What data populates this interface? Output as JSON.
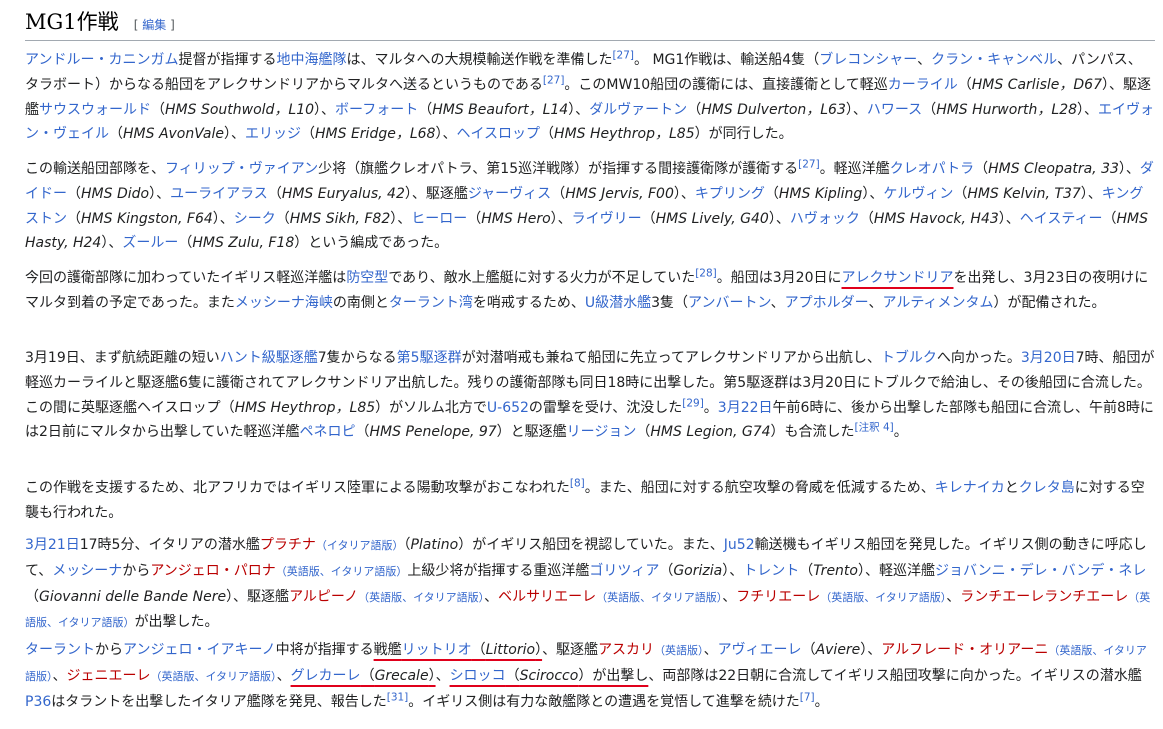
{
  "heading": {
    "title": "MG1作戦",
    "edit_label": "編集",
    "bracket_open": "[",
    "bracket_close": "]"
  },
  "paragraphs": [
    {
      "id": "p1",
      "parts": [
        [
          "link",
          "アンドルー・カニンガム"
        ],
        [
          "text",
          "提督が指揮する"
        ],
        [
          "link",
          "地中海艦隊"
        ],
        [
          "text",
          "は、マルタへの大規模輸送作戦を準備した"
        ],
        [
          "sup",
          "[27]"
        ],
        [
          "text",
          "。 MG1作戦は、輸送船4隻（"
        ],
        [
          "link",
          "ブレコンシャー"
        ],
        [
          "text",
          "、"
        ],
        [
          "link",
          "クラン・キャンベル"
        ],
        [
          "text",
          "、パンパス、タラボート）からなる船団をアレクサンドリアからマルタへ送るというものである"
        ],
        [
          "sup",
          "[27]"
        ],
        [
          "text",
          "。このMW10船団の護衛には、直接護衛として軽巡"
        ],
        [
          "link",
          "カーライル"
        ],
        [
          "text",
          "（"
        ],
        [
          "it",
          "HMS Carlisle，D67"
        ],
        [
          "text",
          "）、駆逐艦"
        ],
        [
          "link",
          "サウスウォールド"
        ],
        [
          "text",
          "（"
        ],
        [
          "it",
          "HMS Southwold，L10"
        ],
        [
          "text",
          "）、"
        ],
        [
          "link",
          "ボーフォート"
        ],
        [
          "text",
          "（"
        ],
        [
          "it",
          "HMS Beaufort，L14"
        ],
        [
          "text",
          "）、"
        ],
        [
          "link",
          "ダルヴァートン"
        ],
        [
          "text",
          "（"
        ],
        [
          "it",
          "HMS Dulverton，L63"
        ],
        [
          "text",
          "）、"
        ],
        [
          "link",
          "ハワース"
        ],
        [
          "text",
          "（"
        ],
        [
          "it",
          "HMS Hurworth，L28"
        ],
        [
          "text",
          "）、"
        ],
        [
          "link",
          "エイヴォン・ヴェイル"
        ],
        [
          "text",
          "（"
        ],
        [
          "it",
          "HMS AvonVale"
        ],
        [
          "text",
          "）、"
        ],
        [
          "link",
          "エリッジ"
        ],
        [
          "text",
          "（"
        ],
        [
          "it",
          "HMS Eridge，L68"
        ],
        [
          "text",
          "）、"
        ],
        [
          "link",
          "ヘイスロップ"
        ],
        [
          "text",
          "（"
        ],
        [
          "it",
          "HMS Heythrop，L85"
        ],
        [
          "text",
          "）が同行した。"
        ]
      ]
    },
    {
      "id": "p2",
      "parts": [
        [
          "text",
          "この輸送船団部隊を、"
        ],
        [
          "link",
          "フィリップ・ヴァイアン"
        ],
        [
          "text",
          "少将（旗艦クレオパトラ、第15巡洋戦隊）が指揮する間接護衛隊が護衛する"
        ],
        [
          "sup",
          "[27]"
        ],
        [
          "text",
          "。軽巡洋艦"
        ],
        [
          "link",
          "クレオパトラ"
        ],
        [
          "text",
          "（"
        ],
        [
          "it",
          "HMS Cleopatra, 33"
        ],
        [
          "text",
          "）、"
        ],
        [
          "link",
          "ダイドー"
        ],
        [
          "text",
          "（"
        ],
        [
          "it",
          "HMS Dido"
        ],
        [
          "text",
          "）、"
        ],
        [
          "link",
          "ユーライアラス"
        ],
        [
          "text",
          "（"
        ],
        [
          "it",
          "HMS Euryalus, 42"
        ],
        [
          "text",
          "）、駆逐艦"
        ],
        [
          "link",
          "ジャーヴィス"
        ],
        [
          "text",
          "（"
        ],
        [
          "it",
          "HMS Jervis, F00"
        ],
        [
          "text",
          "）、"
        ],
        [
          "link",
          "キプリング"
        ],
        [
          "text",
          "（"
        ],
        [
          "it",
          "HMS Kipling"
        ],
        [
          "text",
          "）、"
        ],
        [
          "link",
          "ケルヴィン"
        ],
        [
          "text",
          "（"
        ],
        [
          "it",
          "HMS Kelvin, T37"
        ],
        [
          "text",
          "）、"
        ],
        [
          "link",
          "キングストン"
        ],
        [
          "text",
          "（"
        ],
        [
          "it",
          "HMS Kingston, F64"
        ],
        [
          "text",
          "）、"
        ],
        [
          "link",
          "シーク"
        ],
        [
          "text",
          "（"
        ],
        [
          "it",
          "HMS Sikh, F82"
        ],
        [
          "text",
          "）、"
        ],
        [
          "link",
          "ヒーロー"
        ],
        [
          "text",
          "（"
        ],
        [
          "it",
          "HMS Hero"
        ],
        [
          "text",
          "）、"
        ],
        [
          "link",
          "ライヴリー"
        ],
        [
          "text",
          "（"
        ],
        [
          "it",
          "HMS Lively, G40"
        ],
        [
          "text",
          "）、"
        ],
        [
          "link",
          "ハヴォック"
        ],
        [
          "text",
          "（"
        ],
        [
          "it",
          "HMS Havock, H43"
        ],
        [
          "text",
          "）、"
        ],
        [
          "link",
          "ヘイスティー"
        ],
        [
          "text",
          "（"
        ],
        [
          "it",
          "HMS Hasty, H24"
        ],
        [
          "text",
          "）、"
        ],
        [
          "link",
          "ズールー"
        ],
        [
          "text",
          "（"
        ],
        [
          "it",
          "HMS Zulu, F18"
        ],
        [
          "text",
          "）という編成であった。"
        ]
      ]
    },
    {
      "id": "p3",
      "parts": [
        [
          "text",
          "今回の護衛部隊に加わっていたイギリス軽巡洋艦は"
        ],
        [
          "link",
          "防空型"
        ],
        [
          "text",
          "であり、敵水上艦艇に対する火力が不足していた"
        ],
        [
          "sup",
          "[28]"
        ],
        [
          "text",
          "。船団は3月20日に"
        ],
        [
          "link_u",
          "アレクサンドリア"
        ],
        [
          "text",
          "を出発し、3月23日の夜明けにマルタ到着の予定であった。また"
        ],
        [
          "link",
          "メッシーナ海峡"
        ],
        [
          "text",
          "の南側と"
        ],
        [
          "link",
          "ターラント湾"
        ],
        [
          "text",
          "を哨戒するため、"
        ],
        [
          "link",
          "U級潜水艦"
        ],
        [
          "text",
          "3隻（"
        ],
        [
          "link",
          "アンバートン"
        ],
        [
          "text",
          "、"
        ],
        [
          "link",
          "アプホルダー"
        ],
        [
          "text",
          "、"
        ],
        [
          "link",
          "アルティメンタム"
        ],
        [
          "text",
          "）が配備された。"
        ]
      ]
    },
    {
      "id": "p4",
      "parts": [
        [
          "text",
          "3月19日、まず航続距離の短い"
        ],
        [
          "link",
          "ハント級駆逐艦"
        ],
        [
          "text",
          "7隻からなる"
        ],
        [
          "link",
          "第5駆逐群"
        ],
        [
          "text",
          "が対潜哨戒も兼ねて船団に先立ってアレクサンドリアから出航し、"
        ],
        [
          "link",
          "トブルク"
        ],
        [
          "text",
          "へ向かった。"
        ],
        [
          "link",
          "3月20日"
        ],
        [
          "text",
          "7時、船団が軽巡カーライルと駆逐艦6隻に護衛されてアレクサンドリア出航した。残りの護衛部隊も同日18時に出撃した。第5駆逐群は3月20日にトブルクで給油し、その後船団に合流した。この間に英駆逐艦ヘイスロップ（"
        ],
        [
          "it",
          "HMS Heythrop，L85"
        ],
        [
          "text",
          "）がソルム北方で"
        ],
        [
          "link",
          "U-652"
        ],
        [
          "text",
          "の雷撃を受け、沈没した"
        ],
        [
          "sup",
          "[29]"
        ],
        [
          "text",
          "。"
        ],
        [
          "link",
          "3月22日"
        ],
        [
          "text",
          "午前6時に、後から出撃した部隊も船団に合流し、午前8時には2日前にマルタから出撃していた軽巡洋艦"
        ],
        [
          "link",
          "ペネロピ"
        ],
        [
          "text",
          "（"
        ],
        [
          "it",
          "HMS Penelope, 97"
        ],
        [
          "text",
          "）と駆逐艦"
        ],
        [
          "link",
          "リージョン"
        ],
        [
          "text",
          "（"
        ],
        [
          "it",
          "HMS Legion, G74"
        ],
        [
          "text",
          "）も合流した"
        ],
        [
          "sup",
          "[注釈 4]"
        ],
        [
          "text",
          "。"
        ]
      ]
    },
    {
      "id": "p5",
      "parts": [
        [
          "text",
          "この作戦を支援するため、北アフリカではイギリス陸軍による陽動攻撃がおこなわれた"
        ],
        [
          "sup",
          "[8]"
        ],
        [
          "text",
          "。また、船団に対する航空攻撃の脅威を低減するため、"
        ],
        [
          "link",
          "キレナイカ"
        ],
        [
          "text",
          "と"
        ],
        [
          "link",
          "クレタ島"
        ],
        [
          "text",
          "に対する空襲も行われた。"
        ]
      ]
    },
    {
      "id": "p6",
      "parts": [
        [
          "link",
          "3月21日"
        ],
        [
          "text",
          "17時5分、イタリアの潜水艦"
        ],
        [
          "red",
          "プラチナ"
        ],
        [
          "small",
          "（イタリア語版）"
        ],
        [
          "text",
          "（"
        ],
        [
          "it",
          "Platino"
        ],
        [
          "text",
          "）がイギリス船団を視認していた。また、"
        ],
        [
          "link",
          "Ju52"
        ],
        [
          "text",
          "輸送機もイギリス船団を発見した。イギリス側の動きに呼応して、"
        ],
        [
          "link",
          "メッシーナ"
        ],
        [
          "text",
          "から"
        ],
        [
          "red",
          "アンジェロ・パロナ"
        ],
        [
          "small",
          "（英語版、イタリア語版）"
        ],
        [
          "text",
          "上級少将が指揮する重巡洋艦"
        ],
        [
          "link",
          "ゴリツィア"
        ],
        [
          "text",
          "（"
        ],
        [
          "it",
          "Gorizia"
        ],
        [
          "text",
          "）、"
        ],
        [
          "link",
          "トレント"
        ],
        [
          "text",
          "（"
        ],
        [
          "it",
          "Trento"
        ],
        [
          "text",
          "）、軽巡洋艦"
        ],
        [
          "link",
          "ジョバンニ・デレ・バンデ・ネレ"
        ],
        [
          "text",
          "（"
        ],
        [
          "it",
          "Giovanni delle Bande Nere"
        ],
        [
          "text",
          "）、駆逐艦"
        ],
        [
          "red",
          "アルピーノ"
        ],
        [
          "small",
          "（英語版、イタリア語版）"
        ],
        [
          "text",
          "、"
        ],
        [
          "red",
          "ベルサリエーレ"
        ],
        [
          "small",
          "（英語版、イタリア語版）"
        ],
        [
          "text",
          "、"
        ],
        [
          "red",
          "フチリエーレ"
        ],
        [
          "small",
          "（英語版、イタリア語版）"
        ],
        [
          "text",
          "、"
        ],
        [
          "red",
          "ランチエーレランチエーレ"
        ],
        [
          "small",
          "（英語版、イタリア語版）"
        ],
        [
          "text",
          "が出撃した。"
        ]
      ]
    },
    {
      "id": "p7",
      "parts": [
        [
          "link",
          "ターラント"
        ],
        [
          "text",
          "から"
        ],
        [
          "link",
          "アンジェロ・イアキーノ"
        ],
        [
          "text",
          "中将が指揮する"
        ],
        [
          "u_start",
          ""
        ],
        [
          "text",
          "戦艦"
        ],
        [
          "link",
          "リットリオ"
        ],
        [
          "text",
          "（"
        ],
        [
          "it",
          "Littorio"
        ],
        [
          "text",
          "）"
        ],
        [
          "u_end",
          ""
        ],
        [
          "text",
          "、駆逐艦"
        ],
        [
          "red",
          "アスカリ"
        ],
        [
          "small",
          "（英語版）"
        ],
        [
          "text",
          "、"
        ],
        [
          "link",
          "アヴィエーレ"
        ],
        [
          "text",
          "（"
        ],
        [
          "it",
          "Aviere"
        ],
        [
          "text",
          "）、"
        ],
        [
          "red",
          "アルフレード・オリアーニ"
        ],
        [
          "small",
          "（英語版、イタリア語版）"
        ],
        [
          "text",
          "、"
        ],
        [
          "red",
          "ジェニエーレ"
        ],
        [
          "small",
          "（英語版、イタリア語版）"
        ],
        [
          "text",
          "、"
        ],
        [
          "u_start",
          ""
        ],
        [
          "link",
          "グレカーレ"
        ],
        [
          "text",
          "（"
        ],
        [
          "it",
          "Grecale"
        ],
        [
          "text",
          "）"
        ],
        [
          "u_end",
          ""
        ],
        [
          "text",
          "、"
        ],
        [
          "u_start",
          ""
        ],
        [
          "link",
          "シロッコ"
        ],
        [
          "text",
          "（"
        ],
        [
          "it",
          "Scirocco"
        ],
        [
          "text",
          "）が出撃し"
        ],
        [
          "u_end",
          ""
        ],
        [
          "text",
          "、両部隊は22日朝に合流してイギリス船団攻撃に向かった。イギリスの潜水艦"
        ],
        [
          "link",
          "P36"
        ],
        [
          "text",
          "はタラントを出撃したイタリア艦隊を発見、報告した"
        ],
        [
          "sup",
          "[31]"
        ],
        [
          "text",
          "。イギリス側は有力な敵艦隊との遭遇を覚悟して進撃を続けた"
        ],
        [
          "sup",
          "[7]"
        ],
        [
          "text",
          "。"
        ]
      ]
    }
  ]
}
